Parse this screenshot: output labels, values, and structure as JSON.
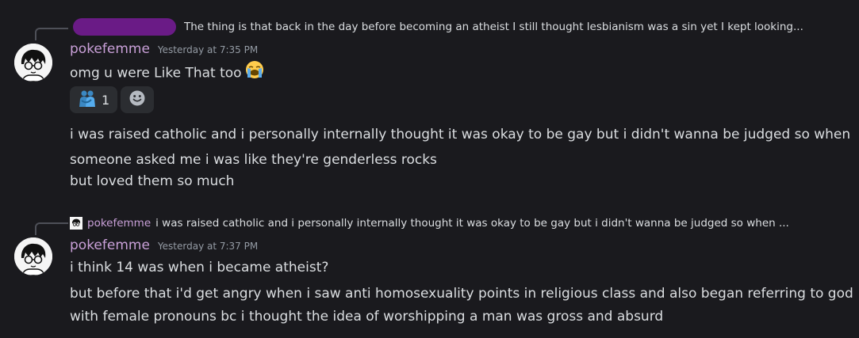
{
  "messages": [
    {
      "reply": {
        "author": "",
        "text": "The thing is that back in the day before becoming an atheist I still thought lesbianism was a sin yet I kept looking..."
      },
      "author": "pokefemme",
      "timestamp": "Yesterday at 7:35 PM",
      "lines": [
        "omg u were Like That too"
      ],
      "inline_emoji": "loudly-crying-face",
      "reactions": [
        {
          "emoji": "people-hugging",
          "count": "1"
        }
      ],
      "add_reaction_icon": "smiley-add-icon"
    },
    {
      "lines": [
        "i was raised catholic and i personally internally thought it was okay to be gay but i didn't wanna be judged so when",
        "someone asked me i was like they're genderless rocks"
      ]
    },
    {
      "lines": [
        "but loved them so much"
      ]
    },
    {
      "reply": {
        "author": "pokefemme",
        "text": "i was raised catholic and i personally internally thought it was okay to be gay but i didn't wanna be judged so when ..."
      },
      "author": "pokefemme",
      "timestamp": "Yesterday at 7:37 PM",
      "lines": [
        "i think 14 was when i became atheist?"
      ]
    },
    {
      "lines": [
        "but before that i'd get angry when i saw anti homosexuality points in religious class and also began referring to god",
        "with female pronouns bc i thought the idea of worshipping a man was gross and absurd"
      ]
    }
  ],
  "colors": {
    "background": "#1a1a1e",
    "username": "#c9a0d8",
    "text": "#dbdee1",
    "timestamp": "#949ba4",
    "redaction": "#6a1b86",
    "reaction_bg": "#2b2d31"
  }
}
